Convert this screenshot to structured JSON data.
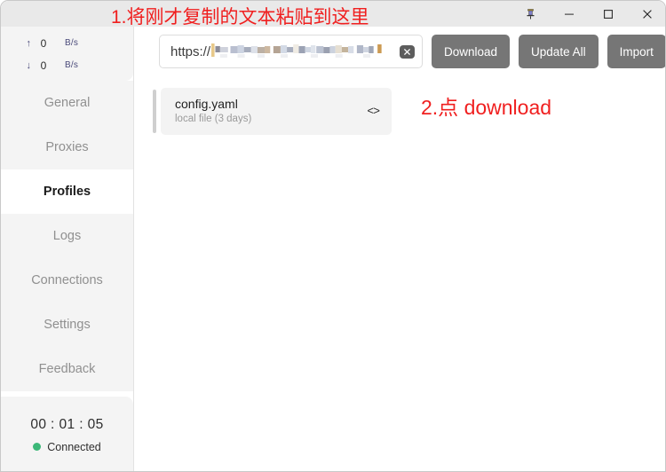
{
  "window": {
    "controls": [
      {
        "name": "pin-button",
        "label": "Pin"
      },
      {
        "name": "minimize-button",
        "label": "Minimize"
      },
      {
        "name": "maximize-button",
        "label": "Maximize"
      },
      {
        "name": "close-button",
        "label": "Close"
      }
    ]
  },
  "sidebar": {
    "traffic": {
      "upload": {
        "arrow": "↑",
        "value": "0",
        "unit": "B/s"
      },
      "download": {
        "arrow": "↓",
        "value": "0",
        "unit": "B/s"
      }
    },
    "items": [
      {
        "label": "General",
        "active": false
      },
      {
        "label": "Proxies",
        "active": false
      },
      {
        "label": "Profiles",
        "active": true
      },
      {
        "label": "Logs",
        "active": false
      },
      {
        "label": "Connections",
        "active": false
      },
      {
        "label": "Settings",
        "active": false
      },
      {
        "label": "Feedback",
        "active": false
      }
    ],
    "status": {
      "timer": "00 : 01 : 05",
      "connection_label": "Connected",
      "connection_color": "#3cb878"
    }
  },
  "main": {
    "url_input": {
      "scheme_text": "https://",
      "value": "",
      "placeholder": "https://",
      "redacted": true,
      "clear_icon": "close-icon"
    },
    "buttons": [
      {
        "label": "Download",
        "name": "download-button"
      },
      {
        "label": "Update All",
        "name": "update-all-button"
      },
      {
        "label": "Import",
        "name": "import-button"
      }
    ],
    "profiles": [
      {
        "title": "config.yaml",
        "subtitle": "local file (3 days)",
        "code_icon": "<>",
        "accent_color": "#cfcfcf"
      }
    ]
  },
  "annotations": [
    {
      "text": "1.将刚才复制的文本粘贴到这里",
      "color": "#f01f1f"
    },
    {
      "text": "2.点 download",
      "color": "#f01f1f"
    }
  ],
  "theme": {
    "accent_button": "#767676",
    "sidebar_bg": "#f4f4f4",
    "titlebar_bg": "#e9e9e9",
    "annotation_red": "#f01f1f"
  }
}
